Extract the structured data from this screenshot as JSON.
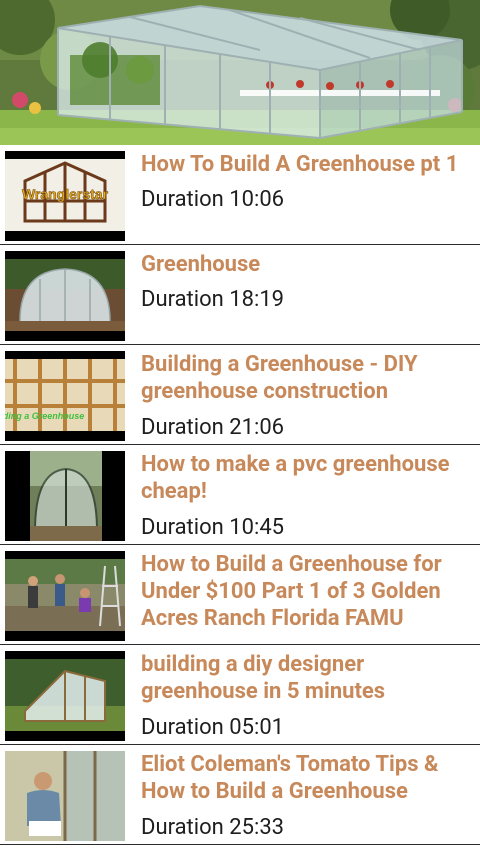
{
  "banner": {
    "icon": "greenhouse-banner-image"
  },
  "videos": [
    {
      "title": "How To Build A Greenhouse pt 1",
      "duration": "Duration 10:06",
      "thumb_text": "Wranglerstar",
      "thumb_icon": "greenhouse-frame-thumbnail"
    },
    {
      "title": "Greenhouse",
      "duration": "Duration 18:19",
      "thumb_icon": "hoop-greenhouse-thumbnail"
    },
    {
      "title": "Building a Greenhouse - DIY greenhouse construction",
      "duration": "Duration 21:06",
      "thumb_text": "Building a Greenhouse",
      "thumb_icon": "wood-greenhouse-thumbnail"
    },
    {
      "title": "How to make a pvc greenhouse cheap!",
      "duration": "Duration 10:45",
      "thumb_icon": "pvc-greenhouse-thumbnail"
    },
    {
      "title": "How to Build a Greenhouse for Under $100 Part 1 of 3  Golden Acres Ranch Florida  FAMU",
      "duration": "",
      "thumb_icon": "outdoor-workers-thumbnail"
    },
    {
      "title": "building a diy designer greenhouse in 5 minutes",
      "duration": "Duration 05:01",
      "thumb_icon": "designer-greenhouse-thumbnail"
    },
    {
      "title": "Eliot Coleman's Tomato Tips & How to Build a Greenhouse",
      "duration": "Duration 25:33",
      "thumb_icon": "man-in-greenhouse-thumbnail"
    }
  ],
  "colors": {
    "title": "#c8895a",
    "duration": "#1e1e1e",
    "divider": "#2b2b2b"
  }
}
